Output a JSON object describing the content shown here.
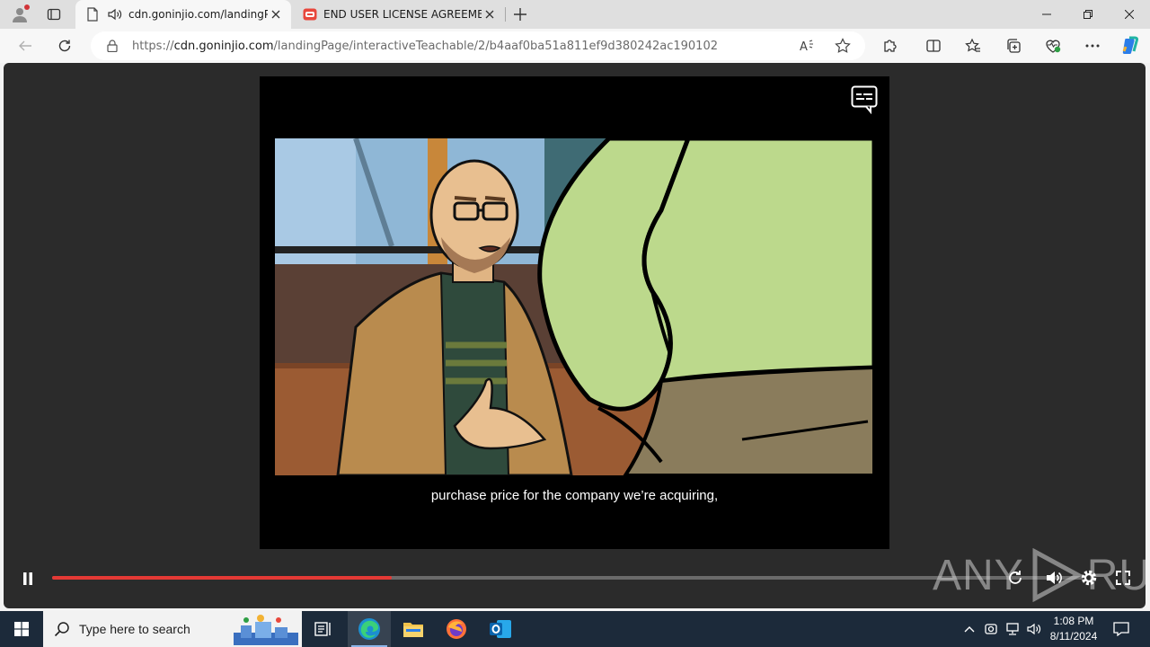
{
  "browser": {
    "tabs": [
      {
        "label": "cdn.goninjio.com/landingP",
        "active": true
      },
      {
        "label": "END USER LICENSE AGREEMENT",
        "active": false
      }
    ],
    "address": {
      "scheme": "https://",
      "host": "cdn.goninjio.com",
      "path": "/landingPage/interactiveTeachable/2/b4aaf0ba51a811ef9d380242ac190102"
    }
  },
  "video": {
    "subtitle": "purchase price for the company we’re acquiring,",
    "progress_fraction": 0.329
  },
  "watermark": {
    "left": "ANY",
    "right": "RUN"
  },
  "taskbar": {
    "search_placeholder": "Type here to search",
    "time": "1:08 PM",
    "date": "8/11/2024"
  },
  "colors": {
    "progress_fill": "#e53935",
    "taskbar_bg": "#1c2a3a",
    "copilot_accent": "#2b7de9"
  }
}
